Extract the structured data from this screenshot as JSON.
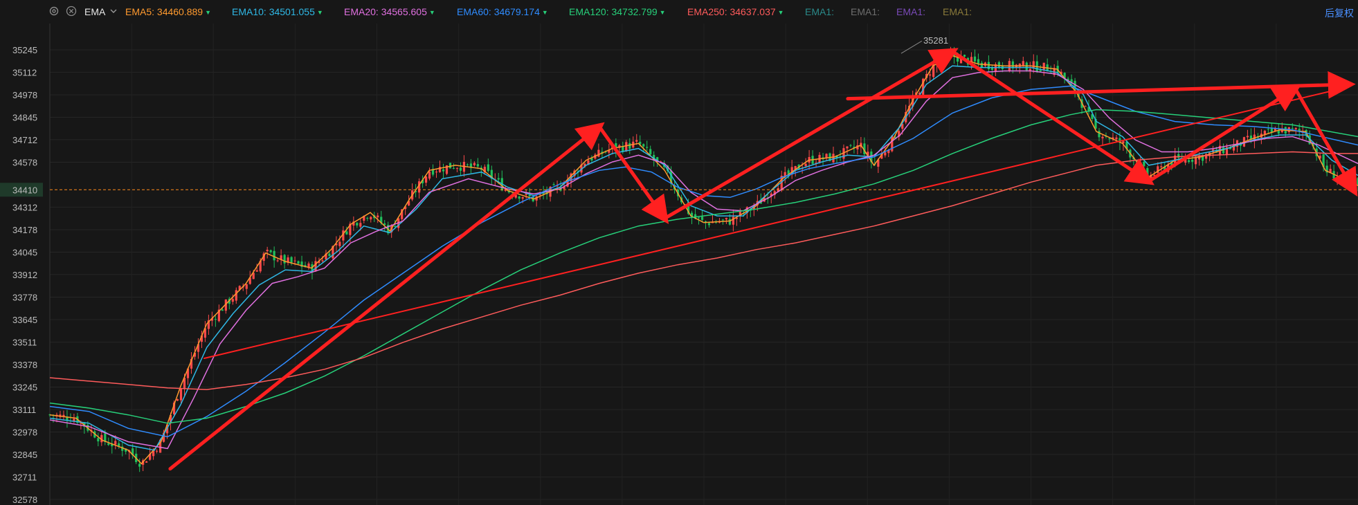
{
  "toolbar": {
    "indicator_label": "EMA",
    "fq_label": "后复权",
    "emas": [
      {
        "label": "EMA5:",
        "value": "34460.889",
        "color": "#ff9a2e"
      },
      {
        "label": "EMA10:",
        "value": "34501.055",
        "color": "#2fb8e6"
      },
      {
        "label": "EMA20:",
        "value": "34565.605",
        "color": "#e070e0"
      },
      {
        "label": "EMA60:",
        "value": "34679.174",
        "color": "#2f8cff"
      },
      {
        "label": "EMA120:",
        "value": "34732.799",
        "color": "#27d07a"
      },
      {
        "label": "EMA250:",
        "value": "34637.037",
        "color": "#ff5b5b"
      }
    ],
    "disabled_emas": [
      {
        "label": "EMA1:",
        "color": "#2a8a8a"
      },
      {
        "label": "EMA1:",
        "color": "#6e6e6e"
      },
      {
        "label": "EMA1:",
        "color": "#7a4ab8"
      },
      {
        "label": "EMA1:",
        "color": "#8a7a3a"
      }
    ],
    "icons": [
      "gear-icon",
      "close-icon",
      "chevron-down-icon"
    ]
  },
  "chart_data": {
    "type": "line",
    "y_ticks": [
      35245,
      35112,
      34978,
      34845,
      34712,
      34578,
      34312,
      34178,
      34045,
      33912,
      33778,
      33645,
      33511,
      33378,
      33245,
      33111,
      32978,
      32845,
      32711,
      32578
    ],
    "ylim": [
      32578,
      35245
    ],
    "current_price_label": "34410",
    "current_price": 34415,
    "high_marker": {
      "label": "35281",
      "x": 0.655,
      "value": 35281
    },
    "candle_up_color": "#ff4a4a",
    "candle_down_color": "#20c05c",
    "x_range": [
      0,
      1
    ],
    "series": [
      {
        "name": "EMA5",
        "color": "#ff9a2e",
        "points": [
          [
            0,
            33080
          ],
          [
            0.02,
            33060
          ],
          [
            0.04,
            32930
          ],
          [
            0.06,
            32870
          ],
          [
            0.07,
            32790
          ],
          [
            0.085,
            32920
          ],
          [
            0.1,
            33250
          ],
          [
            0.12,
            33620
          ],
          [
            0.135,
            33740
          ],
          [
            0.15,
            33860
          ],
          [
            0.165,
            34040
          ],
          [
            0.18,
            33990
          ],
          [
            0.2,
            33950
          ],
          [
            0.215,
            34060
          ],
          [
            0.23,
            34210
          ],
          [
            0.245,
            34280
          ],
          [
            0.26,
            34170
          ],
          [
            0.275,
            34360
          ],
          [
            0.29,
            34530
          ],
          [
            0.31,
            34560
          ],
          [
            0.33,
            34540
          ],
          [
            0.35,
            34410
          ],
          [
            0.37,
            34360
          ],
          [
            0.39,
            34430
          ],
          [
            0.41,
            34590
          ],
          [
            0.43,
            34660
          ],
          [
            0.45,
            34690
          ],
          [
            0.47,
            34530
          ],
          [
            0.49,
            34260
          ],
          [
            0.5,
            34220
          ],
          [
            0.52,
            34230
          ],
          [
            0.54,
            34320
          ],
          [
            0.56,
            34480
          ],
          [
            0.58,
            34590
          ],
          [
            0.6,
            34610
          ],
          [
            0.62,
            34680
          ],
          [
            0.63,
            34560
          ],
          [
            0.645,
            34720
          ],
          [
            0.66,
            34950
          ],
          [
            0.675,
            35150
          ],
          [
            0.69,
            35210
          ],
          [
            0.71,
            35160
          ],
          [
            0.73,
            35150
          ],
          [
            0.75,
            35150
          ],
          [
            0.77,
            35130
          ],
          [
            0.785,
            34990
          ],
          [
            0.8,
            34760
          ],
          [
            0.82,
            34690
          ],
          [
            0.84,
            34490
          ],
          [
            0.86,
            34590
          ],
          [
            0.88,
            34610
          ],
          [
            0.9,
            34660
          ],
          [
            0.92,
            34720
          ],
          [
            0.94,
            34770
          ],
          [
            0.96,
            34760
          ],
          [
            0.975,
            34530
          ],
          [
            1,
            34440
          ]
        ]
      },
      {
        "name": "EMA10",
        "color": "#2fb8e6",
        "points": [
          [
            0,
            33060
          ],
          [
            0.03,
            33030
          ],
          [
            0.06,
            32900
          ],
          [
            0.08,
            32870
          ],
          [
            0.1,
            33140
          ],
          [
            0.12,
            33480
          ],
          [
            0.14,
            33680
          ],
          [
            0.16,
            33850
          ],
          [
            0.18,
            33940
          ],
          [
            0.2,
            33930
          ],
          [
            0.22,
            34050
          ],
          [
            0.24,
            34200
          ],
          [
            0.26,
            34160
          ],
          [
            0.28,
            34300
          ],
          [
            0.3,
            34480
          ],
          [
            0.33,
            34520
          ],
          [
            0.35,
            34430
          ],
          [
            0.37,
            34380
          ],
          [
            0.39,
            34430
          ],
          [
            0.41,
            34560
          ],
          [
            0.43,
            34630
          ],
          [
            0.45,
            34660
          ],
          [
            0.47,
            34560
          ],
          [
            0.49,
            34320
          ],
          [
            0.51,
            34260
          ],
          [
            0.53,
            34260
          ],
          [
            0.55,
            34400
          ],
          [
            0.57,
            34530
          ],
          [
            0.59,
            34580
          ],
          [
            0.61,
            34620
          ],
          [
            0.63,
            34610
          ],
          [
            0.65,
            34790
          ],
          [
            0.67,
            35040
          ],
          [
            0.69,
            35150
          ],
          [
            0.71,
            35140
          ],
          [
            0.73,
            35140
          ],
          [
            0.75,
            35140
          ],
          [
            0.77,
            35110
          ],
          [
            0.79,
            34980
          ],
          [
            0.8,
            34820
          ],
          [
            0.82,
            34730
          ],
          [
            0.84,
            34560
          ],
          [
            0.86,
            34590
          ],
          [
            0.88,
            34630
          ],
          [
            0.9,
            34660
          ],
          [
            0.92,
            34710
          ],
          [
            0.94,
            34740
          ],
          [
            0.96,
            34740
          ],
          [
            0.98,
            34590
          ],
          [
            1,
            34500
          ]
        ]
      },
      {
        "name": "EMA20",
        "color": "#e070e0",
        "points": [
          [
            0,
            33050
          ],
          [
            0.03,
            33010
          ],
          [
            0.06,
            32920
          ],
          [
            0.09,
            32880
          ],
          [
            0.11,
            33180
          ],
          [
            0.13,
            33500
          ],
          [
            0.15,
            33700
          ],
          [
            0.17,
            33860
          ],
          [
            0.19,
            33900
          ],
          [
            0.21,
            33950
          ],
          [
            0.23,
            34100
          ],
          [
            0.25,
            34170
          ],
          [
            0.27,
            34230
          ],
          [
            0.29,
            34400
          ],
          [
            0.32,
            34480
          ],
          [
            0.35,
            34420
          ],
          [
            0.37,
            34390
          ],
          [
            0.39,
            34420
          ],
          [
            0.41,
            34510
          ],
          [
            0.43,
            34580
          ],
          [
            0.45,
            34620
          ],
          [
            0.47,
            34570
          ],
          [
            0.49,
            34400
          ],
          [
            0.51,
            34300
          ],
          [
            0.53,
            34290
          ],
          [
            0.55,
            34370
          ],
          [
            0.57,
            34470
          ],
          [
            0.59,
            34530
          ],
          [
            0.61,
            34580
          ],
          [
            0.63,
            34620
          ],
          [
            0.65,
            34740
          ],
          [
            0.67,
            34940
          ],
          [
            0.69,
            35080
          ],
          [
            0.71,
            35110
          ],
          [
            0.73,
            35120
          ],
          [
            0.75,
            35120
          ],
          [
            0.77,
            35100
          ],
          [
            0.79,
            35010
          ],
          [
            0.81,
            34840
          ],
          [
            0.83,
            34710
          ],
          [
            0.85,
            34640
          ],
          [
            0.87,
            34640
          ],
          [
            0.89,
            34660
          ],
          [
            0.91,
            34690
          ],
          [
            0.93,
            34720
          ],
          [
            0.95,
            34730
          ],
          [
            0.97,
            34680
          ],
          [
            1,
            34570
          ]
        ]
      },
      {
        "name": "EMA60",
        "color": "#2f8cff",
        "points": [
          [
            0,
            33130
          ],
          [
            0.03,
            33100
          ],
          [
            0.06,
            33000
          ],
          [
            0.09,
            32950
          ],
          [
            0.12,
            33070
          ],
          [
            0.15,
            33220
          ],
          [
            0.18,
            33390
          ],
          [
            0.21,
            33570
          ],
          [
            0.24,
            33760
          ],
          [
            0.27,
            33920
          ],
          [
            0.3,
            34080
          ],
          [
            0.33,
            34220
          ],
          [
            0.36,
            34340
          ],
          [
            0.39,
            34450
          ],
          [
            0.42,
            34530
          ],
          [
            0.44,
            34550
          ],
          [
            0.46,
            34520
          ],
          [
            0.48,
            34430
          ],
          [
            0.5,
            34380
          ],
          [
            0.52,
            34370
          ],
          [
            0.54,
            34420
          ],
          [
            0.56,
            34490
          ],
          [
            0.58,
            34540
          ],
          [
            0.6,
            34570
          ],
          [
            0.63,
            34610
          ],
          [
            0.66,
            34720
          ],
          [
            0.69,
            34870
          ],
          [
            0.72,
            34960
          ],
          [
            0.75,
            35010
          ],
          [
            0.78,
            35030
          ],
          [
            0.8,
            34970
          ],
          [
            0.83,
            34880
          ],
          [
            0.86,
            34820
          ],
          [
            0.89,
            34800
          ],
          [
            0.92,
            34790
          ],
          [
            0.95,
            34770
          ],
          [
            1,
            34680
          ]
        ]
      },
      {
        "name": "EMA120",
        "color": "#27d07a",
        "points": [
          [
            0,
            33150
          ],
          [
            0.03,
            33120
          ],
          [
            0.06,
            33080
          ],
          [
            0.09,
            33030
          ],
          [
            0.12,
            33060
          ],
          [
            0.15,
            33130
          ],
          [
            0.18,
            33210
          ],
          [
            0.21,
            33310
          ],
          [
            0.24,
            33430
          ],
          [
            0.27,
            33560
          ],
          [
            0.3,
            33690
          ],
          [
            0.33,
            33820
          ],
          [
            0.36,
            33940
          ],
          [
            0.39,
            34040
          ],
          [
            0.42,
            34130
          ],
          [
            0.45,
            34200
          ],
          [
            0.48,
            34240
          ],
          [
            0.51,
            34270
          ],
          [
            0.54,
            34300
          ],
          [
            0.57,
            34340
          ],
          [
            0.6,
            34390
          ],
          [
            0.63,
            34450
          ],
          [
            0.66,
            34530
          ],
          [
            0.69,
            34630
          ],
          [
            0.72,
            34720
          ],
          [
            0.75,
            34800
          ],
          [
            0.78,
            34860
          ],
          [
            0.8,
            34890
          ],
          [
            0.83,
            34880
          ],
          [
            0.86,
            34860
          ],
          [
            0.89,
            34840
          ],
          [
            0.92,
            34820
          ],
          [
            0.95,
            34800
          ],
          [
            1,
            34730
          ]
        ]
      },
      {
        "name": "EMA250",
        "color": "#ff5b5b",
        "points": [
          [
            0,
            33300
          ],
          [
            0.03,
            33280
          ],
          [
            0.06,
            33260
          ],
          [
            0.09,
            33240
          ],
          [
            0.12,
            33230
          ],
          [
            0.15,
            33260
          ],
          [
            0.18,
            33300
          ],
          [
            0.21,
            33350
          ],
          [
            0.24,
            33420
          ],
          [
            0.27,
            33510
          ],
          [
            0.3,
            33590
          ],
          [
            0.33,
            33660
          ],
          [
            0.36,
            33730
          ],
          [
            0.39,
            33790
          ],
          [
            0.42,
            33860
          ],
          [
            0.45,
            33920
          ],
          [
            0.48,
            33970
          ],
          [
            0.51,
            34010
          ],
          [
            0.54,
            34060
          ],
          [
            0.57,
            34100
          ],
          [
            0.6,
            34150
          ],
          [
            0.63,
            34200
          ],
          [
            0.66,
            34260
          ],
          [
            0.69,
            34320
          ],
          [
            0.72,
            34390
          ],
          [
            0.75,
            34460
          ],
          [
            0.78,
            34520
          ],
          [
            0.8,
            34560
          ],
          [
            0.83,
            34590
          ],
          [
            0.86,
            34610
          ],
          [
            0.89,
            34620
          ],
          [
            0.92,
            34630
          ],
          [
            0.95,
            34640
          ],
          [
            0.98,
            34630
          ],
          [
            1,
            34630
          ]
        ]
      }
    ],
    "trend_lines": [
      {
        "from": [
          0.118,
          33415
        ],
        "to": [
          0.993,
          35025
        ],
        "color": "#ff2020",
        "thin": true
      },
      {
        "from": [
          0.092,
          32760
        ],
        "to": [
          0.42,
          34790
        ],
        "color": "#ff2020"
      },
      {
        "from": [
          0.42,
          34790
        ],
        "to": [
          0.47,
          34245
        ],
        "color": "#ff2020"
      },
      {
        "from": [
          0.47,
          34245
        ],
        "to": [
          0.69,
          35235
        ],
        "color": "#ff2020"
      },
      {
        "from": [
          0.69,
          35235
        ],
        "to": [
          0.84,
          34465
        ],
        "color": "#ff2020"
      },
      {
        "from": [
          0.84,
          34465
        ],
        "to": [
          0.952,
          35015
        ],
        "color": "#ff2020"
      },
      {
        "from": [
          0.952,
          35015
        ],
        "to": [
          0.997,
          34410
        ],
        "color": "#ff2020"
      },
      {
        "from": [
          0.61,
          34955
        ],
        "to": [
          0.993,
          35040
        ],
        "color": "#ff2020"
      }
    ]
  }
}
